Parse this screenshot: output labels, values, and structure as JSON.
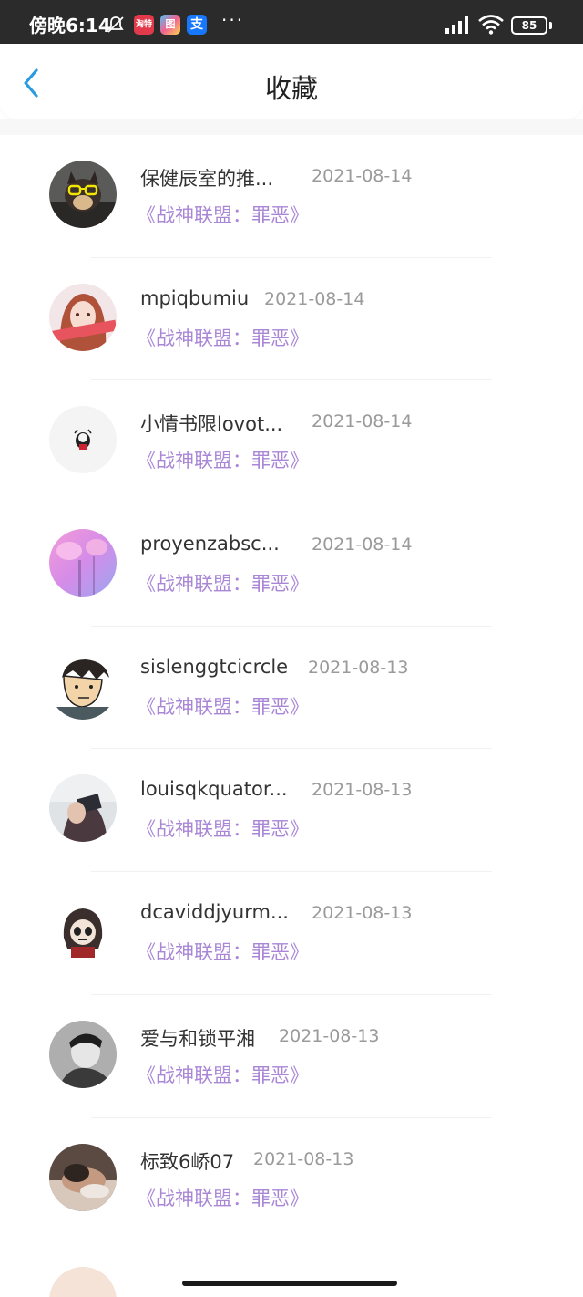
{
  "status_bar": {
    "time": "傍晚6:14",
    "app_icons": [
      "淘特",
      "图",
      "支"
    ],
    "more": "···",
    "battery": "85"
  },
  "header": {
    "title": "收藏",
    "back_icon": "chevron-left-icon"
  },
  "colors": {
    "accent_blue": "#2a9be0",
    "book_purple": "#a987d6",
    "date_gray": "#9a9a9a"
  },
  "favorites": [
    {
      "user": "保健辰室的推...",
      "date": "2021-08-14",
      "book": "《战神联盟：罪恶》"
    },
    {
      "user": "mpiqbumiu",
      "date": "2021-08-14",
      "book": "《战神联盟：罪恶》"
    },
    {
      "user": "小情书限lovot...",
      "date": "2021-08-14",
      "book": "《战神联盟：罪恶》"
    },
    {
      "user": "proyenzabsc...",
      "date": "2021-08-14",
      "book": "《战神联盟：罪恶》"
    },
    {
      "user": "sislenggtcicrcle",
      "date": "2021-08-13",
      "book": "《战神联盟：罪恶》"
    },
    {
      "user": "louisqkquator...",
      "date": "2021-08-13",
      "book": "《战神联盟：罪恶》"
    },
    {
      "user": "dcaviddjyurm...",
      "date": "2021-08-13",
      "book": "《战神联盟：罪恶》"
    },
    {
      "user": "爱与和锁平湘",
      "date": "2021-08-13",
      "book": "《战神联盟：罪恶》"
    },
    {
      "user": "标致6峤07",
      "date": "2021-08-13",
      "book": "《战神联盟：罪恶》"
    }
  ]
}
